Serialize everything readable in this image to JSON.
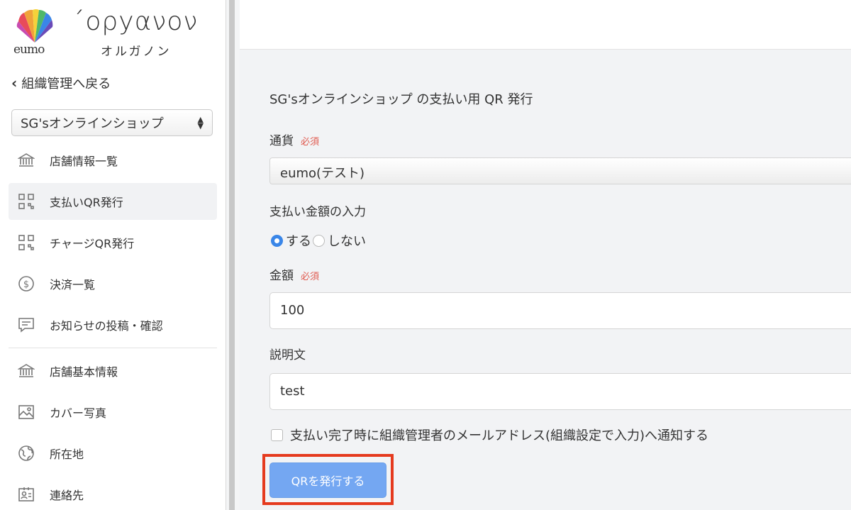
{
  "brand": {
    "logo_text": "eumo",
    "name": "´ορyανον",
    "name_kana": "オルガノン"
  },
  "sidebar": {
    "back_label": "組織管理へ戻る",
    "shop_select_value": "SG'sオンラインショップ",
    "items": [
      {
        "label": "店舗情報一覧",
        "icon": "bank-icon"
      },
      {
        "label": "支払いQR発行",
        "icon": "qr-code-icon"
      },
      {
        "label": "チャージQR発行",
        "icon": "qr-code-icon"
      },
      {
        "label": "決済一覧",
        "icon": "dollar-icon"
      },
      {
        "label": "お知らせの投稿・確認",
        "icon": "message-icon"
      },
      {
        "label": "店舗基本情報",
        "icon": "bank-icon"
      },
      {
        "label": "カバー写真",
        "icon": "image-icon"
      },
      {
        "label": "所在地",
        "icon": "globe-icon"
      },
      {
        "label": "連絡先",
        "icon": "contact-card-icon"
      }
    ]
  },
  "form": {
    "title": "SG'sオンラインショップ の支払い用 QR 発行",
    "currency_label": "通貨",
    "required_label": "必須",
    "currency_value": "eumo(テスト)",
    "amount_input_label": "支払い金額の入力",
    "radio_yes": "する",
    "radio_no": "しない",
    "amount_label": "金額",
    "amount_value": "100",
    "description_label": "説明文",
    "description_value": "test",
    "notify_label": "支払い完了時に組織管理者のメールアドレス(組織設定で入力)へ通知する",
    "submit_label": "QRを発行する"
  },
  "colors": {
    "accent": "#3a86e8",
    "button": "#74a7f2",
    "required": "#e05a4f",
    "highlight": "#e53a1e"
  }
}
